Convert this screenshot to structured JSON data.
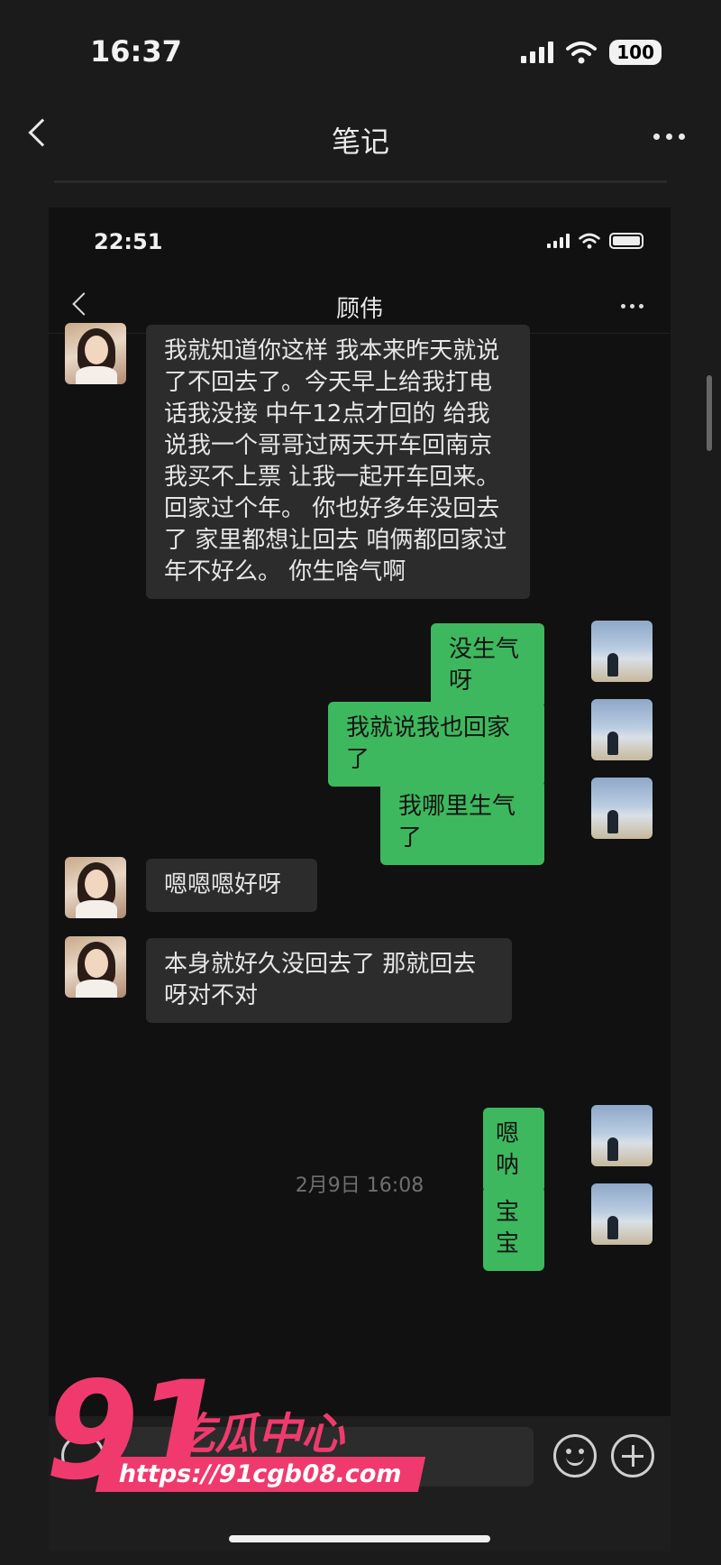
{
  "outer_status": {
    "time": "16:37",
    "battery": "100"
  },
  "outer_header": {
    "title": "笔记"
  },
  "inner_status": {
    "time": "22:51"
  },
  "chat_header": {
    "title": "顾伟"
  },
  "messages": [
    {
      "side": "left",
      "text": "我就知道你这样 我本来昨天就说了不回去了。今天早上给我打电话我没接 中午12点才回的 给我说我一个哥哥过两天开车回南京 我买不上票 让我一起开车回来。回家过个年。 你也好多年没回去了 家里都想让回去 咱俩都回家过年不好么。 你生啥气啊"
    },
    {
      "side": "right",
      "text": "没生气呀"
    },
    {
      "side": "right",
      "text": "我就说我也回家了"
    },
    {
      "side": "right",
      "text": "我哪里生气了"
    },
    {
      "side": "left",
      "text": "嗯嗯嗯好呀"
    },
    {
      "side": "left",
      "text": "本身就好久没回去了 那就回去呀对不对"
    },
    {
      "side": "right",
      "text": "嗯呐"
    },
    {
      "side": "right",
      "text": "宝宝"
    }
  ],
  "timestamp": "2月9日 16:08",
  "watermark": {
    "number": "91",
    "name": "吃瓜中心",
    "url": "https://91cgb08.com"
  },
  "colors": {
    "sent_bubble": "#3eb85e",
    "received_bubble": "#2c2c2c",
    "watermark": "#f03a6e"
  }
}
